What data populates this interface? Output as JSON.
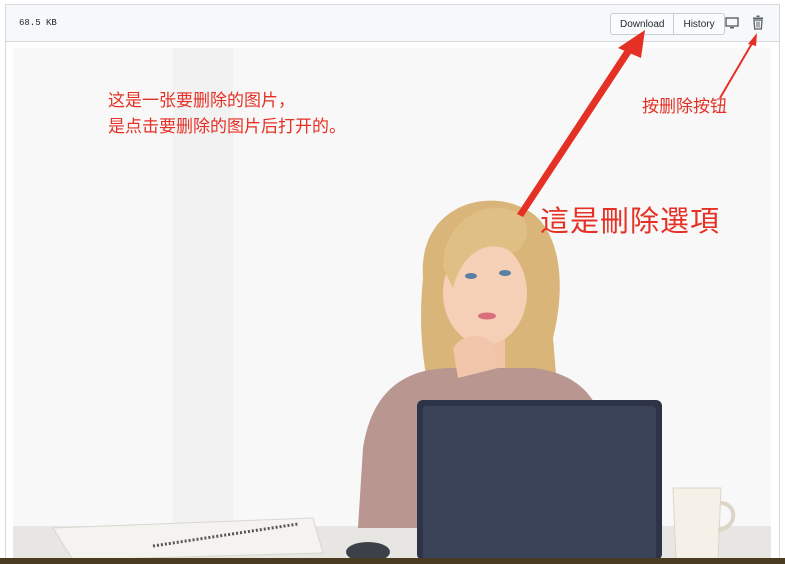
{
  "file": {
    "size": "68.5 KB"
  },
  "toolbar": {
    "download_label": "Download",
    "history_label": "History",
    "desktop_icon": "desktop-icon",
    "trash_icon": "trash-icon"
  },
  "annotations": {
    "main_line1": "这是一张要删除的图片，",
    "main_line2": "是点击要删除的图片后打开的。",
    "delete_button_note": "按删除按钮",
    "delete_option_note": "這是刪除選項",
    "accent_color": "#e53025"
  },
  "image": {
    "subject": "woman at laptop thinking"
  }
}
